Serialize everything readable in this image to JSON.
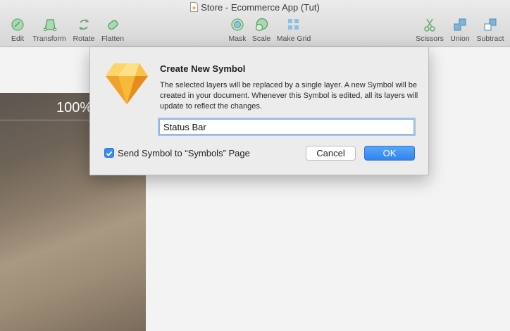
{
  "window": {
    "title": "Store - Ecommerce App (Tut)"
  },
  "toolbar": {
    "left": [
      {
        "label": "Edit",
        "icon": "edit-icon"
      },
      {
        "label": "Transform",
        "icon": "transform-icon"
      },
      {
        "label": "Rotate",
        "icon": "rotate-icon"
      },
      {
        "label": "Flatten",
        "icon": "flatten-icon"
      }
    ],
    "center": [
      {
        "label": "Mask",
        "icon": "mask-icon"
      },
      {
        "label": "Scale",
        "icon": "scale-icon"
      },
      {
        "label": "Make Grid",
        "icon": "make-grid-icon"
      }
    ],
    "right": [
      {
        "label": "Scissors",
        "icon": "scissors-icon"
      },
      {
        "label": "Union",
        "icon": "union-icon"
      },
      {
        "label": "Subtract",
        "icon": "subtract-icon"
      }
    ]
  },
  "canvas": {
    "artboard_text": "100%"
  },
  "dialog": {
    "title": "Create New Symbol",
    "body": "The selected layers will be replaced by a single layer. A new Symbol will be created in your document. Whenever this Symbol is edited, all its layers will update to reflect the changes.",
    "name_value": "Status Bar",
    "checkbox_label": "Send Symbol to “Symbols” Page",
    "checkbox_checked": true,
    "cancel_label": "Cancel",
    "ok_label": "OK"
  },
  "colors": {
    "accent": "#3b8df0",
    "tool_green": "#7fbf8a",
    "tool_blue": "#7aaed6"
  }
}
